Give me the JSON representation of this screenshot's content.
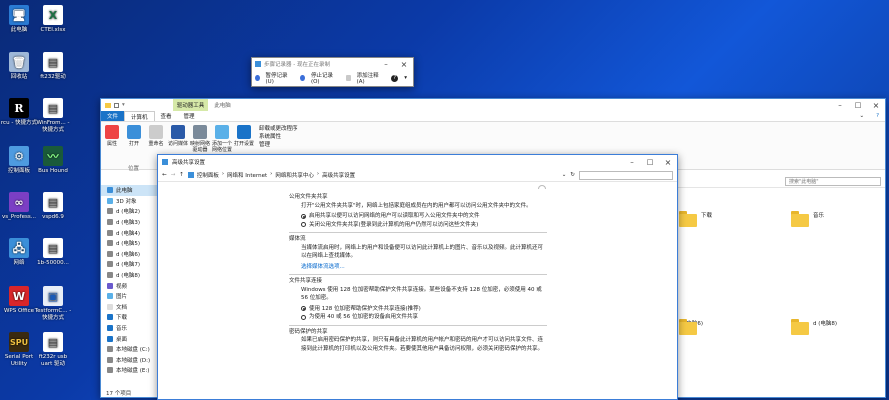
{
  "desktop": {
    "icons": [
      {
        "label": "此电脑"
      },
      {
        "label": "CTEI.xlsx"
      },
      {
        "label": "回收站"
      },
      {
        "label": "ft232驱动"
      },
      {
        "label": "rcu - 快捷方式"
      },
      {
        "label": "WinFrom... - 快捷方式"
      },
      {
        "label": "控制面板"
      },
      {
        "label": "Bus Hound"
      },
      {
        "label": "vs_Profess..."
      },
      {
        "label": "vspd6.9"
      },
      {
        "label": "网络"
      },
      {
        "label": "1b-50000..."
      },
      {
        "label": "WPS Office"
      },
      {
        "label": "TestformC... - 快捷方式"
      },
      {
        "label": "Serial Port Utility"
      },
      {
        "label": "ft232r usb uart 驱动"
      }
    ]
  },
  "recorder": {
    "title": "步骤记录器 - 现在正在录制",
    "pause": "暂停记录(U)",
    "stop": "停止记录(O)",
    "comment": "添加注释(A)",
    "help": "?"
  },
  "explorer": {
    "tab_drive_tools": "驱动器工具",
    "title": "此电脑",
    "tabs": [
      "文件",
      "计算机",
      "查看",
      "管理"
    ],
    "ribbon": [
      {
        "label": "属性"
      },
      {
        "label": "打开"
      },
      {
        "label": "重命名"
      },
      {
        "label": "访问媒体"
      },
      {
        "label": "映射网络驱动器"
      },
      {
        "label": "添加一个网络位置"
      },
      {
        "label": "打开设置"
      }
    ],
    "ribbon_small": [
      "卸载或更改程序",
      "系统属性",
      "管理"
    ],
    "group_location": "位置",
    "search_placeholder": "搜索\"此电脑\"",
    "nav": [
      "此电脑",
      "3D 对象",
      "d (电脑2)",
      "d (电脑3)",
      "d (电脑4)",
      "d (电脑5)",
      "d (电脑6)",
      "d (电脑7)",
      "d (电脑8)",
      "视频",
      "图片",
      "文档",
      "下载",
      "音乐",
      "桌面",
      "本地磁盘 (C:)",
      "本地磁盘 (D:)",
      "本地磁盘 (E:)"
    ],
    "folders": [
      {
        "label": "下载"
      },
      {
        "label": "音乐"
      },
      {
        "label": "d (电脑6)"
      },
      {
        "label": "d (电脑8)"
      }
    ],
    "status": "17 个项目"
  },
  "dialog": {
    "title": "高级共享设置",
    "breadcrumb": [
      "控制面板",
      "网络和 Internet",
      "网络和共享中心",
      "高级共享设置"
    ],
    "search_placeholder": "",
    "sections": {
      "public_folder": {
        "head": "公用文件夹共享",
        "desc": "打开\"公用文件夹共享\"时，网络上包括家庭组成员在内的用户都可以访问公用文件夹中的文件。",
        "opt_on": "启用共享以便可以访问网络的用户可以读取和写入公用文件夹中的文件",
        "opt_off": "关闭公用文件夹共享(登录到此计算机的用户仍然可以访问这些文件夹)"
      },
      "media": {
        "head": "媒体流",
        "desc": "当媒体流启用时，网络上的用户和设备便可以访问此计算机上的图片、音乐以及视频。此计算机还可以在网络上查找媒体。",
        "link": "选择媒体流选项..."
      },
      "file_sharing": {
        "head": "文件共享连接",
        "desc": "Windows 使用 128 位加密帮助保护文件共享连接。某些设备不支持 128 位加密，必须使用 40 或 56 位加密。",
        "opt_128": "使用 128 位加密帮助保护文件共享连接(推荐)",
        "opt_40": "为使用 40 或 56 位加密的设备启用文件共享"
      },
      "password": {
        "head": "密码保护的共享",
        "desc": "如果已启用密码保护的共享，则只有具备此计算机的用户帐户和密码的用户才可以访问共享文件、连接到此计算机的打印机以及公用文件夹。若要使其他用户具备访问权限，必须关闭密码保护的共享。"
      }
    }
  }
}
